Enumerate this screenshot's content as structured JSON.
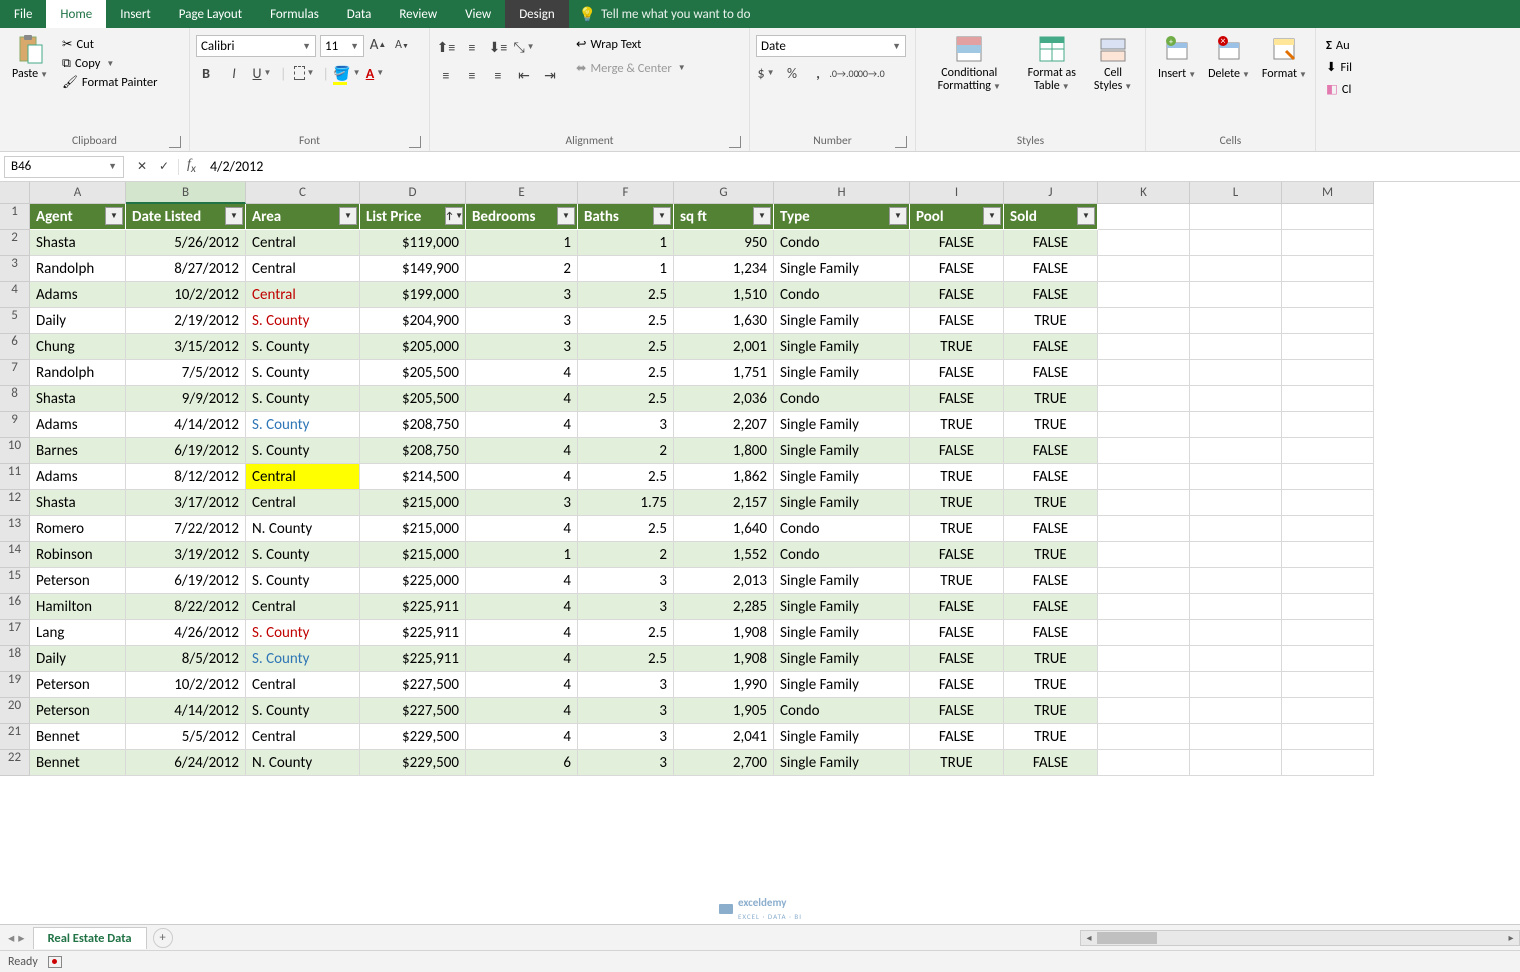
{
  "menu_tabs": [
    "File",
    "Home",
    "Insert",
    "Page Layout",
    "Formulas",
    "Data",
    "Review",
    "View",
    "Design"
  ],
  "active_tab": "Home",
  "tell_me": "Tell me what you want to do",
  "clipboard": {
    "paste": "Paste",
    "cut": "Cut",
    "copy": "Copy",
    "fp": "Format Painter",
    "label": "Clipboard"
  },
  "font": {
    "name": "Calibri",
    "size": "11",
    "label": "Font"
  },
  "alignment": {
    "wrap": "Wrap Text",
    "merge": "Merge & Center",
    "label": "Alignment"
  },
  "number": {
    "format": "Date",
    "label": "Number"
  },
  "styles": {
    "cond": "Conditional Formatting",
    "fat": "Format as Table",
    "cs": "Cell Styles",
    "label": "Styles"
  },
  "cells": {
    "ins": "Insert",
    "del": "Delete",
    "fmt": "Format",
    "label": "Cells"
  },
  "editing": {
    "au": "Au",
    "fil": "Fil",
    "cl": "Cl"
  },
  "namebox": "B46",
  "formula": "4/2/2012",
  "columns": [
    "A",
    "B",
    "C",
    "D",
    "E",
    "F",
    "G",
    "H",
    "I",
    "J",
    "K",
    "L",
    "M"
  ],
  "headers": [
    "Agent",
    "Date Listed",
    "Area",
    "List Price",
    "Bedrooms",
    "Baths",
    "sq ft",
    "Type",
    "Pool",
    "Sold"
  ],
  "rows": [
    {
      "n": 2,
      "band": 1,
      "d": [
        "Shasta",
        "5/26/2012",
        "Central",
        "$119,000",
        "1",
        "1",
        "950",
        "Condo",
        "FALSE",
        "FALSE"
      ]
    },
    {
      "n": 3,
      "band": 0,
      "d": [
        "Randolph",
        "8/27/2012",
        "Central",
        "$149,900",
        "2",
        "1",
        "1,234",
        "Single Family",
        "FALSE",
        "FALSE"
      ]
    },
    {
      "n": 4,
      "band": 1,
      "d": [
        "Adams",
        "10/2/2012",
        "Central",
        "$199,000",
        "3",
        "2.5",
        "1,510",
        "Condo",
        "FALSE",
        "FALSE"
      ],
      "area_cls": "red-t"
    },
    {
      "n": 5,
      "band": 0,
      "d": [
        "Daily",
        "2/19/2012",
        "S. County",
        "$204,900",
        "3",
        "2.5",
        "1,630",
        "Single Family",
        "FALSE",
        "TRUE"
      ],
      "area_cls": "red-t"
    },
    {
      "n": 6,
      "band": 1,
      "d": [
        "Chung",
        "3/15/2012",
        "S. County",
        "$205,000",
        "3",
        "2.5",
        "2,001",
        "Single Family",
        "TRUE",
        "FALSE"
      ]
    },
    {
      "n": 7,
      "band": 0,
      "d": [
        "Randolph",
        "7/5/2012",
        "S. County",
        "$205,500",
        "4",
        "2.5",
        "1,751",
        "Single Family",
        "FALSE",
        "FALSE"
      ]
    },
    {
      "n": 8,
      "band": 1,
      "d": [
        "Shasta",
        "9/9/2012",
        "S. County",
        "$205,500",
        "4",
        "2.5",
        "2,036",
        "Condo",
        "FALSE",
        "TRUE"
      ]
    },
    {
      "n": 9,
      "band": 0,
      "d": [
        "Adams",
        "4/14/2012",
        "S. County",
        "$208,750",
        "4",
        "3",
        "2,207",
        "Single Family",
        "TRUE",
        "TRUE"
      ],
      "area_cls": "blue-t"
    },
    {
      "n": 10,
      "band": 1,
      "d": [
        "Barnes",
        "6/19/2012",
        "S. County",
        "$208,750",
        "4",
        "2",
        "1,800",
        "Single Family",
        "FALSE",
        "FALSE"
      ]
    },
    {
      "n": 11,
      "band": 0,
      "d": [
        "Adams",
        "8/12/2012",
        "Central",
        "$214,500",
        "4",
        "2.5",
        "1,862",
        "Single Family",
        "TRUE",
        "FALSE"
      ],
      "area_bg": "yellow-bg"
    },
    {
      "n": 12,
      "band": 1,
      "d": [
        "Shasta",
        "3/17/2012",
        "Central",
        "$215,000",
        "3",
        "1.75",
        "2,157",
        "Single Family",
        "TRUE",
        "TRUE"
      ]
    },
    {
      "n": 13,
      "band": 0,
      "d": [
        "Romero",
        "7/22/2012",
        "N. County",
        "$215,000",
        "4",
        "2.5",
        "1,640",
        "Condo",
        "TRUE",
        "FALSE"
      ]
    },
    {
      "n": 14,
      "band": 1,
      "d": [
        "Robinson",
        "3/19/2012",
        "S. County",
        "$215,000",
        "1",
        "2",
        "1,552",
        "Condo",
        "FALSE",
        "TRUE"
      ]
    },
    {
      "n": 15,
      "band": 0,
      "d": [
        "Peterson",
        "6/19/2012",
        "S. County",
        "$225,000",
        "4",
        "3",
        "2,013",
        "Single Family",
        "TRUE",
        "FALSE"
      ]
    },
    {
      "n": 16,
      "band": 1,
      "d": [
        "Hamilton",
        "8/22/2012",
        "Central",
        "$225,911",
        "4",
        "3",
        "2,285",
        "Single Family",
        "FALSE",
        "FALSE"
      ]
    },
    {
      "n": 17,
      "band": 0,
      "d": [
        "Lang",
        "4/26/2012",
        "S. County",
        "$225,911",
        "4",
        "2.5",
        "1,908",
        "Single Family",
        "FALSE",
        "FALSE"
      ],
      "area_cls": "red-t"
    },
    {
      "n": 18,
      "band": 1,
      "d": [
        "Daily",
        "8/5/2012",
        "S. County",
        "$225,911",
        "4",
        "2.5",
        "1,908",
        "Single Family",
        "FALSE",
        "TRUE"
      ],
      "area_cls": "blue-t"
    },
    {
      "n": 19,
      "band": 0,
      "d": [
        "Peterson",
        "10/2/2012",
        "Central",
        "$227,500",
        "4",
        "3",
        "1,990",
        "Single Family",
        "FALSE",
        "TRUE"
      ]
    },
    {
      "n": 20,
      "band": 1,
      "d": [
        "Peterson",
        "4/14/2012",
        "S. County",
        "$227,500",
        "4",
        "3",
        "1,905",
        "Condo",
        "FALSE",
        "TRUE"
      ]
    },
    {
      "n": 21,
      "band": 0,
      "d": [
        "Bennet",
        "5/5/2012",
        "Central",
        "$229,500",
        "4",
        "3",
        "2,041",
        "Single Family",
        "FALSE",
        "TRUE"
      ]
    },
    {
      "n": 22,
      "band": 1,
      "d": [
        "Bennet",
        "6/24/2012",
        "N. County",
        "$229,500",
        "6",
        "3",
        "2,700",
        "Single Family",
        "TRUE",
        "FALSE"
      ]
    }
  ],
  "sheet_tab": "Real Estate Data",
  "watermark": "exceldemy",
  "watermark_sub": "EXCEL · DATA · BI",
  "status": "Ready"
}
